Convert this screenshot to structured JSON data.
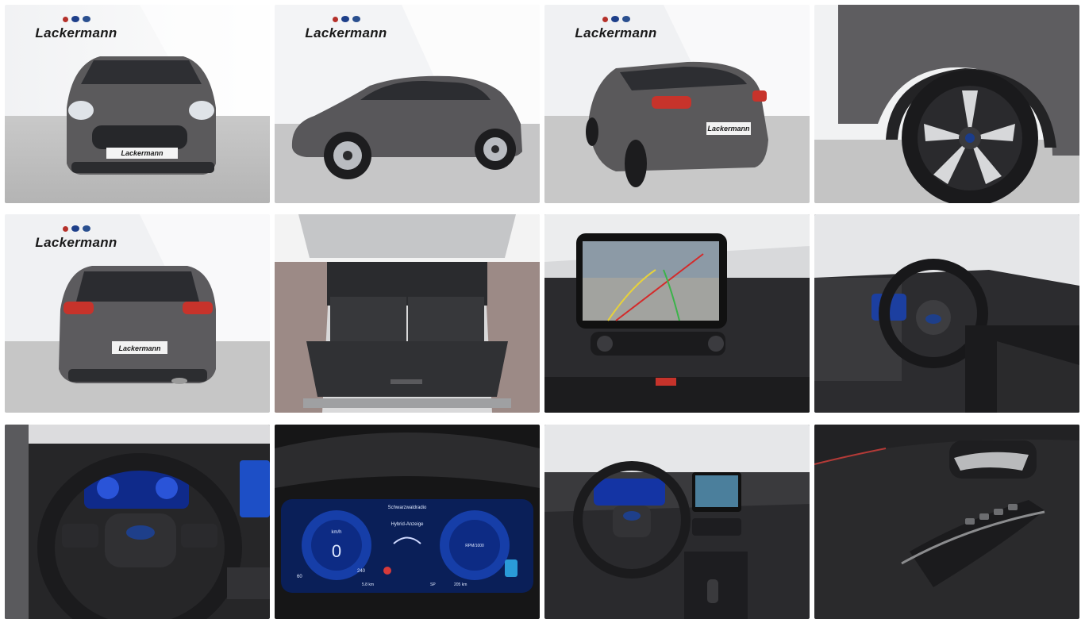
{
  "gallery": {
    "dealer_logo": "Lackermann",
    "plate_text": "Lackermann",
    "cluster": {
      "speed": "0",
      "speed_unit": "km/h",
      "mode_label": "Hybrid-Anzeige",
      "track_label": "Schwarzwaldradio",
      "rpm_label": "RPM/1000",
      "odo_left": "60",
      "range_left": "240",
      "trip": "5.8 km",
      "gear": "SP",
      "range_right": "205 km"
    }
  }
}
